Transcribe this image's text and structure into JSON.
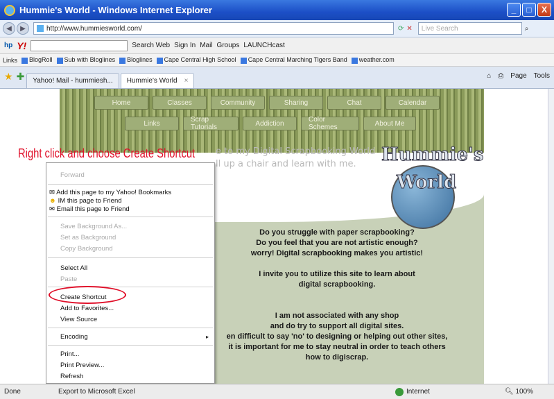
{
  "window": {
    "title": "Hummie's World - Windows Internet Explorer",
    "minimize": "_",
    "maximize": "□",
    "close": "X"
  },
  "address": {
    "url": "http://www.hummiesworld.com/",
    "search_placeholder": "Live Search"
  },
  "yahoo_toolbar": {
    "search_web": "Search Web",
    "sign_in": "Sign In",
    "mail": "Mail",
    "groups": "Groups",
    "launchcast": "LAUNCHcast"
  },
  "links_bar": {
    "label": "Links",
    "items": [
      "BlogRoll",
      "Sub with Bloglines",
      "Bloglines",
      "Cape Central High School",
      "Cape Central Marching Tigers Band",
      "weather.com"
    ]
  },
  "tabs": [
    {
      "label": "Yahoo! Mail - hummiesh..."
    },
    {
      "label": "Hummie's World"
    }
  ],
  "tab_tools": {
    "page": "Page",
    "tools": "Tools"
  },
  "site": {
    "nav_row1": [
      "Home",
      "Classes",
      "Community",
      "Sharing",
      "Chat",
      "Calendar"
    ],
    "nav_row2": [
      "Links",
      "Scrap Tutorials",
      "Addiction",
      "Color Schemes",
      "About Me"
    ],
    "welcome_line1": "e to my Digital Scrapbooking World",
    "welcome_line2": "ll up a chair and learn with me.",
    "logo_line1": "Hummie's",
    "logo_line2": "World",
    "paragraphs": [
      "Do you struggle with paper scrapbooking?",
      "Do you feel that you are not artistic enough?",
      "worry!  Digital scrapbooking makes you artistic!",
      "",
      "I invite you to utilize this site to learn about",
      "digital scrapbooking.",
      "",
      "",
      "I am not associated with any shop",
      "and do try to support all digital sites.",
      "en difficult to say 'no' to designing or helping out other sites,",
      "it is important for me to stay neutral in order to teach others",
      "how to digiscrap."
    ]
  },
  "annotation": "Right click and choose Create Shortcut",
  "context_menu": {
    "forward": "Forward",
    "yahoo_bookmark": "Add this page to my Yahoo! Bookmarks",
    "im_friend": "IM this page to Friend",
    "email_friend": "Email this page to Friend",
    "save_background": "Save Background As...",
    "set_background": "Set as Background",
    "copy_background": "Copy Background",
    "select_all": "Select All",
    "paste": "Paste",
    "create_shortcut": "Create Shortcut",
    "add_favorites": "Add to Favorites...",
    "view_source": "View Source",
    "encoding": "Encoding",
    "print": "Print...",
    "print_preview": "Print Preview...",
    "refresh": "Refresh",
    "export_excel": "Export to Microsoft Excel"
  },
  "status": {
    "text": "Done",
    "zone": "Internet",
    "zoom": "100%"
  }
}
